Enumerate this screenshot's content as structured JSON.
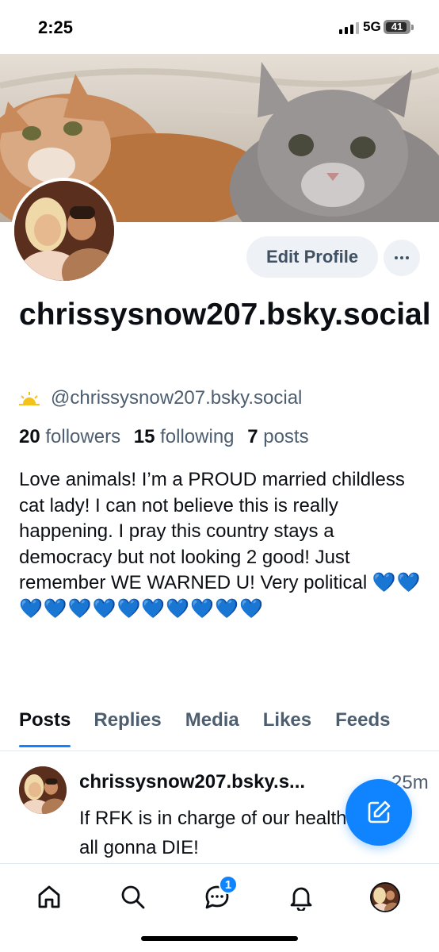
{
  "status_bar": {
    "time": "2:25",
    "network": "5G",
    "battery": "41"
  },
  "header": {
    "banner_image": "two-cats-photo",
    "avatar_image": "couple-photo"
  },
  "actions": {
    "edit_profile_label": "Edit Profile",
    "more_label": "···"
  },
  "profile": {
    "display_name": "chrissysnow207.bsky.social",
    "handle": "@chrissysnow207.bsky.social",
    "handle_icon": "sun-icon",
    "followers_count": "20",
    "followers_label": "followers",
    "following_count": "15",
    "following_label": "following",
    "posts_count": "7",
    "posts_label": "posts",
    "bio": "Love animals! I’m a PROUD married childless cat lady! I can not believe this is really happening.  I pray this country stays a democracy but not looking 2 good! Just remember WE WARNED U! Very political",
    "bio_hearts": "💙💙💙💙💙💙💙💙💙💙💙💙"
  },
  "tabs": [
    {
      "label": "Posts",
      "active": true
    },
    {
      "label": "Replies",
      "active": false
    },
    {
      "label": "Media",
      "active": false
    },
    {
      "label": "Likes",
      "active": false
    },
    {
      "label": "Feeds",
      "active": false
    }
  ],
  "post": {
    "author": "chrissysnow207.bsky.s...",
    "time": "25m",
    "text": "If RFK is in charge of our health we r all gonna DIE!"
  },
  "bottom_nav": {
    "items": [
      "home-icon",
      "search-icon",
      "chat-icon",
      "bell-icon",
      "profile-avatar"
    ],
    "chat_badge": "1"
  },
  "colors": {
    "accent": "#1083fe",
    "muted_text": "#4d5e70",
    "button_bg": "#eef2f6"
  }
}
